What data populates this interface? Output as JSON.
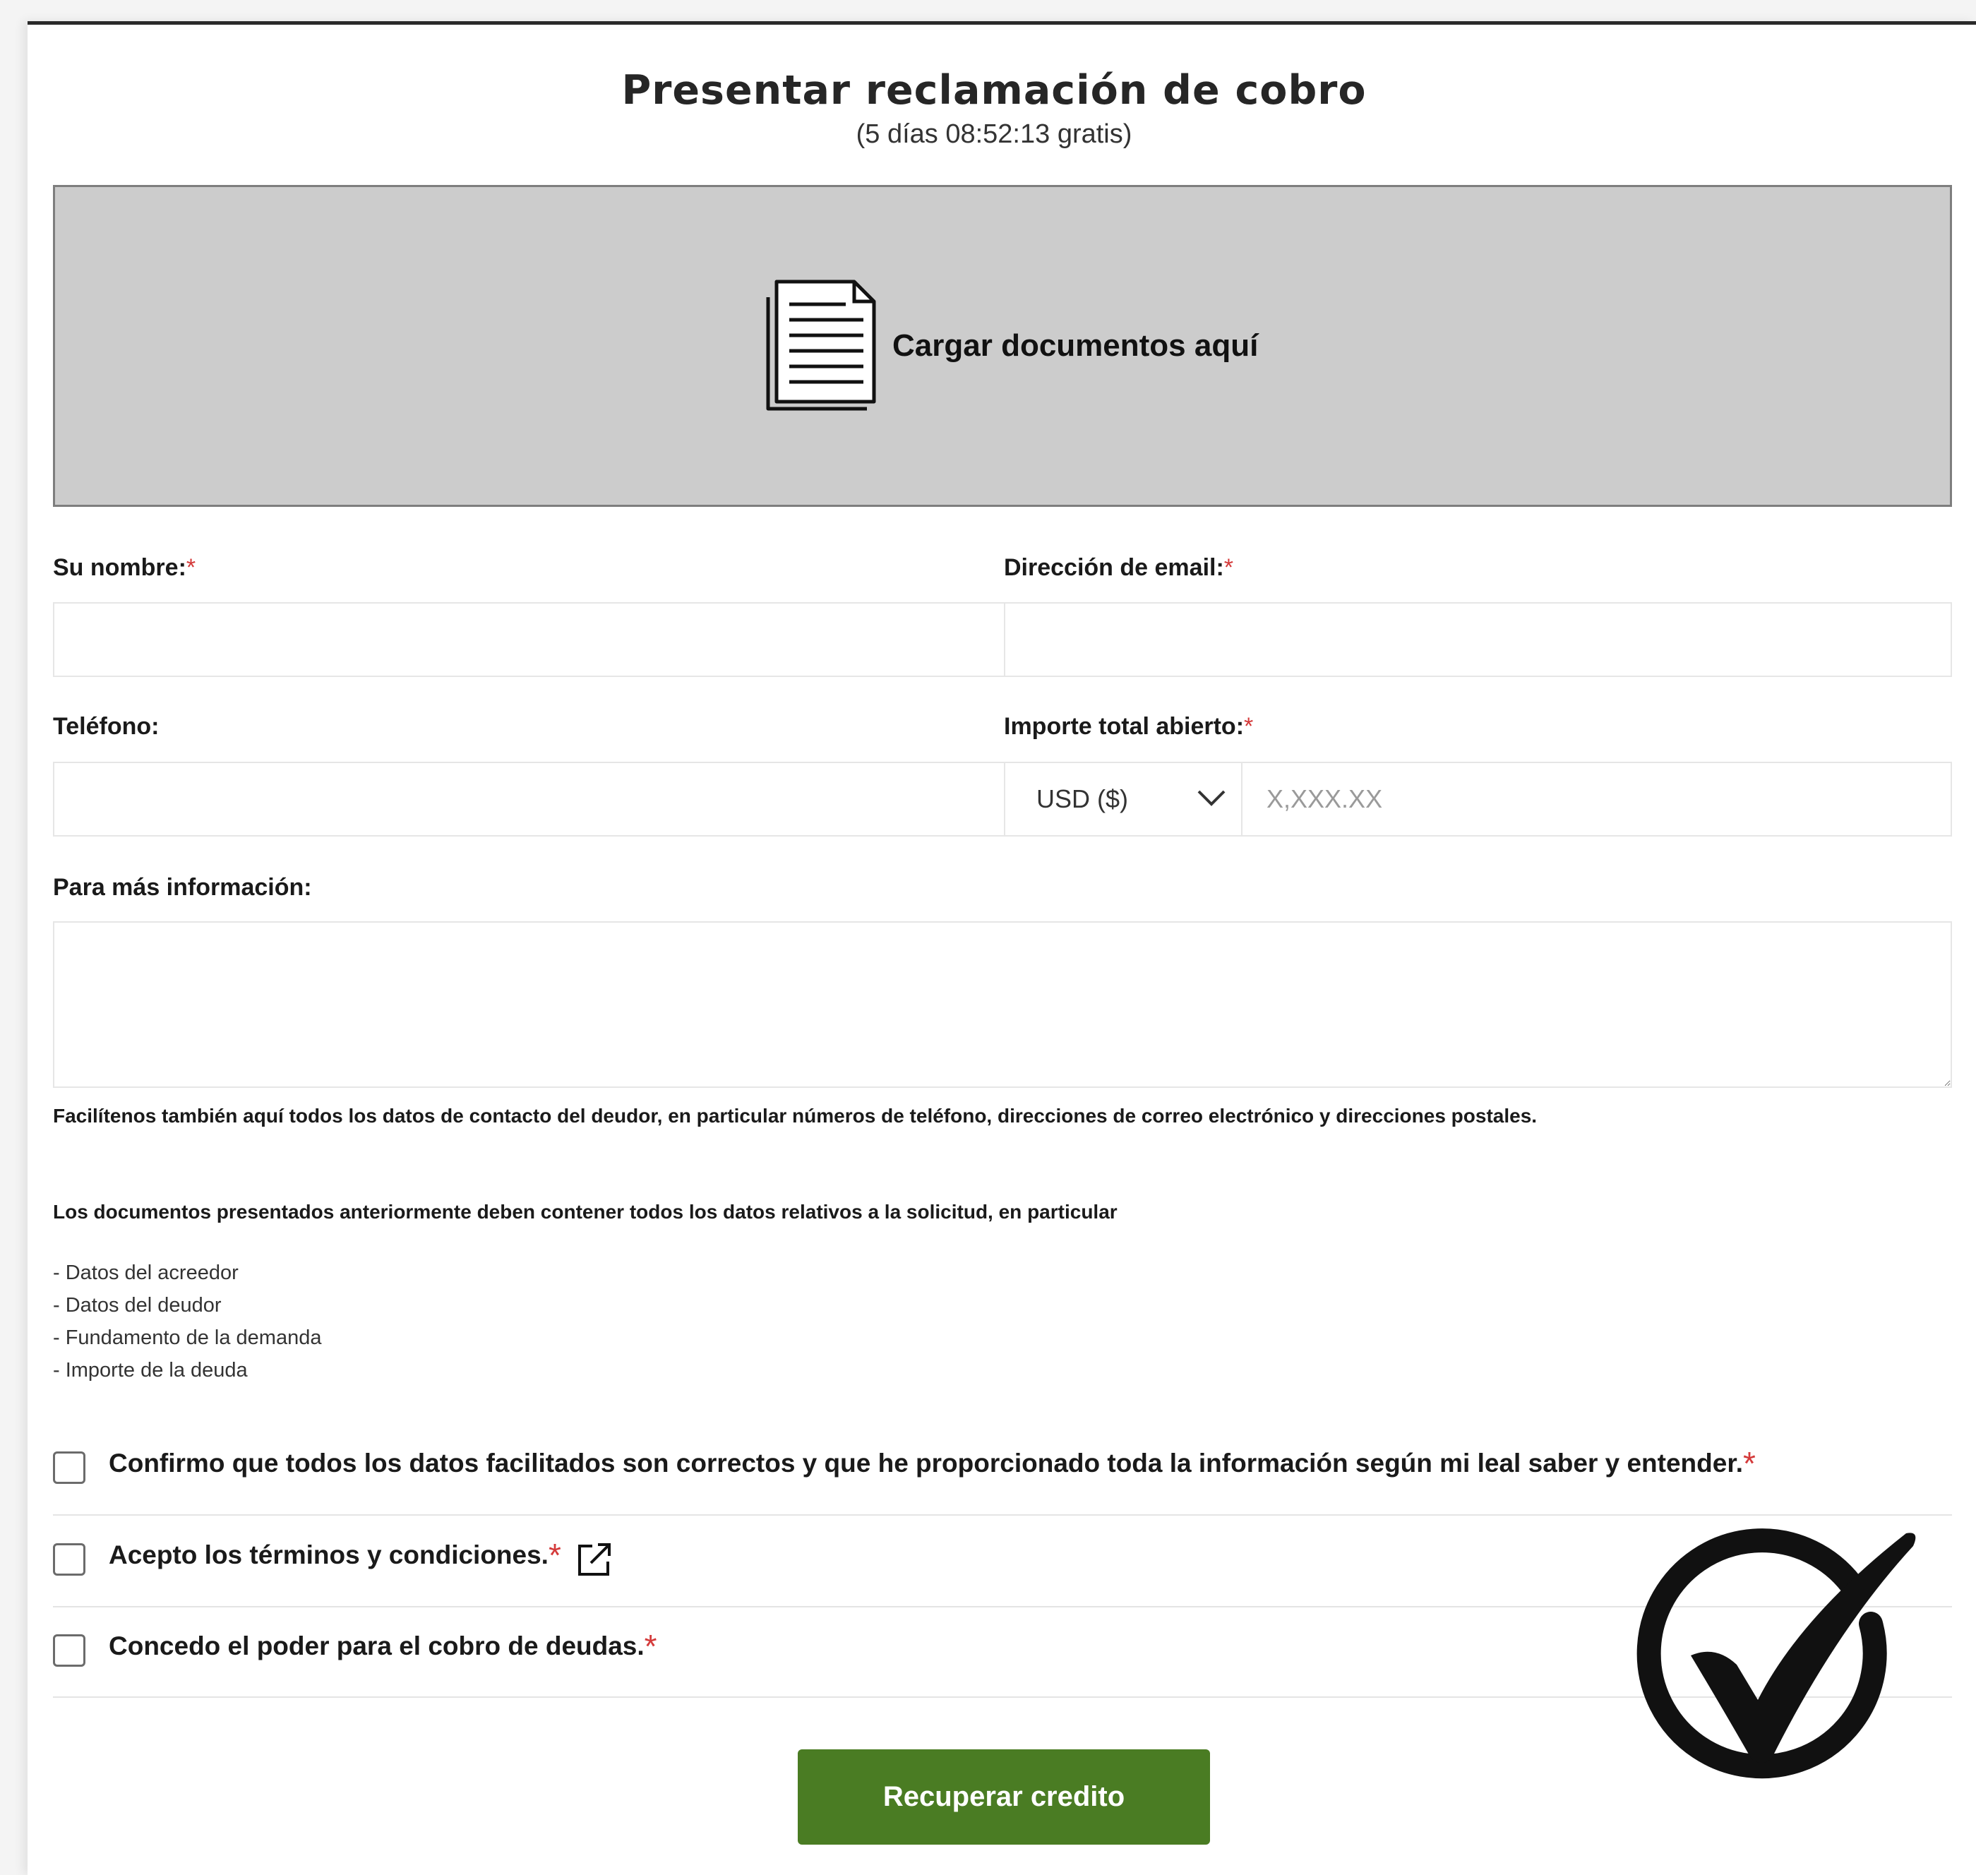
{
  "header": {
    "title": "Presentar reclamación de cobro",
    "subtitle": "(5 días 08:52:13 gratis)"
  },
  "upload": {
    "label": "Cargar documentos aquí",
    "icon": "document-icon"
  },
  "form": {
    "name_label": "Su nombre:",
    "email_label": "Dirección de email:",
    "phone_label": "Teléfono:",
    "amount_label": "Importe total abierto:",
    "required_mark": "*",
    "currency_value": "USD ($)",
    "amount_placeholder": "X,XXX.XX",
    "info_label": "Para más información:"
  },
  "help": {
    "contact_note": "Facilítenos también aquí todos los datos de contacto del deudor, en particular números de teléfono, direcciones de correo electrónico y direcciones postales.",
    "documents_note": "Los documentos presentados anteriormente deben contener todos los datos relativos a la solicitud, en particular",
    "items": [
      "- Datos del acreedor",
      "- Datos del deudor",
      "- Fundamento de la demanda",
      "- Importe de la deuda"
    ]
  },
  "checks": [
    {
      "label": "Confirmo que todos los datos facilitados son correctos y que he proporcionado toda la información según mi leal saber y entender.",
      "checked": false
    },
    {
      "label": "Acepto los términos y condiciones.",
      "checked": false
    },
    {
      "label": "Concedo el poder para el cobro de deudas.",
      "checked": false
    }
  ],
  "submit_label": "Recuperar credito",
  "colors": {
    "accent_green": "#4a7c23",
    "required_red": "#d43a3a",
    "upload_bg": "#cccccc"
  }
}
